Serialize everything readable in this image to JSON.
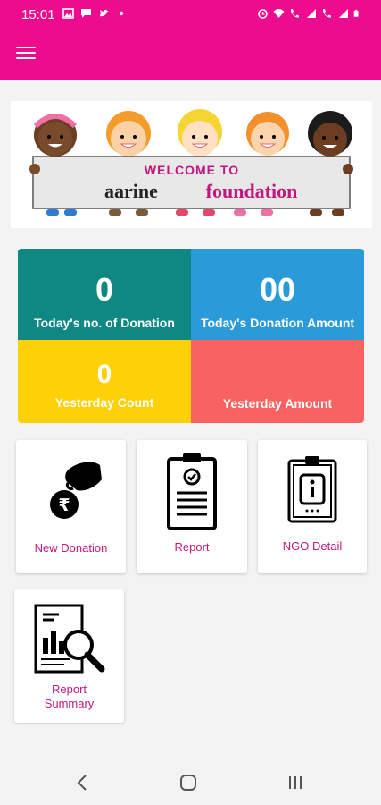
{
  "status_bar": {
    "time": "15:01",
    "icons_left": [
      "image-icon",
      "message-icon",
      "twitter-icon",
      "dot-icon"
    ],
    "icons_right": [
      "alarm-icon",
      "wifi-icon",
      "volte-call-icon",
      "signal-icon",
      "volte-call-icon",
      "signal-icon",
      "battery-icon"
    ]
  },
  "app_bar": {
    "menu_icon": "hamburger-menu-icon",
    "background": "#ec0c8d"
  },
  "banner": {
    "line1": "WELCOME TO",
    "word1": "aarine",
    "word2": "foundation"
  },
  "stats": [
    {
      "value": "0",
      "label": "Today's no. of Donation",
      "color": "#0f8783"
    },
    {
      "value": "00",
      "label": "Today's Donation Amount",
      "color": "#2b9ad8"
    },
    {
      "value": "0",
      "label": "Yesterday Count",
      "color": "#fdd007"
    },
    {
      "value": "",
      "label": "Yesterday Amount",
      "color": "#f86361"
    }
  ],
  "tiles": [
    {
      "label": "New Donation",
      "icon": "donation-hand-icon"
    },
    {
      "label": "Report",
      "icon": "clipboard-report-icon"
    },
    {
      "label": "NGO Detail",
      "icon": "info-clipboard-icon"
    },
    {
      "label_line1": "Report",
      "label_line2": "Summary",
      "icon": "report-magnifier-icon"
    }
  ],
  "nav_bar": {
    "back": "back-icon",
    "home": "home-icon",
    "recents": "recents-icon"
  },
  "accent": "#c0187f"
}
